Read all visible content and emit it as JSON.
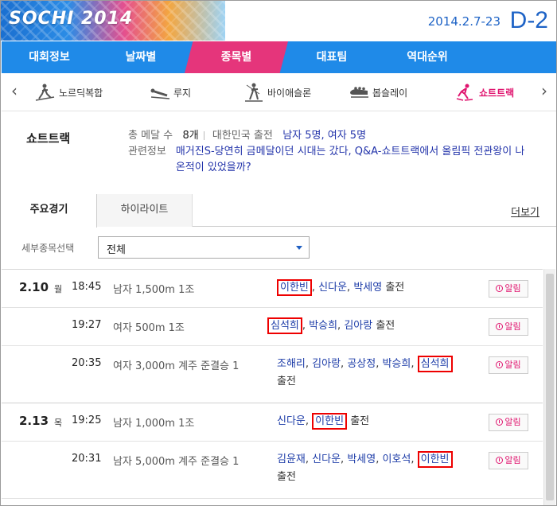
{
  "header": {
    "logo": "SOCHI 2014",
    "dates": "2014.2.7-23",
    "dday": "D-2"
  },
  "main_nav": [
    "대회정보",
    "날짜별",
    "종목별",
    "대표팀",
    "역대순위"
  ],
  "main_nav_active": "종목별",
  "sports": [
    {
      "label": "노르딕복합",
      "icon": "nordic-combined-icon"
    },
    {
      "label": "루지",
      "icon": "luge-icon"
    },
    {
      "label": "바이애슬론",
      "icon": "biathlon-icon"
    },
    {
      "label": "봅슬레이",
      "icon": "bobsleigh-icon"
    },
    {
      "label": "쇼트트랙",
      "icon": "short-track-icon",
      "active": true
    }
  ],
  "sport_info": {
    "title": "쇼트트랙",
    "medal_label": "총 메달 수",
    "medal_value": "8개",
    "entry_label": "대한민국 출전",
    "entry_value": "남자 5명, 여자 5명",
    "related_label": "관련정보",
    "related_link": "매거진S-당연히 금메달이던 시대는 갔다, Q&A-쇼트트랙에서 올림픽 전관왕이 나온적이 있었을까?"
  },
  "tabs": [
    "주요경기",
    "하이라이트"
  ],
  "more_label": "더보기",
  "filter": {
    "label": "세부종목선택",
    "value": "전체"
  },
  "schedule": [
    {
      "date": "2.10",
      "dow": "월",
      "time": "18:45",
      "event": "남자 1,500m 1조",
      "athletes": [
        {
          "name": "이한빈",
          "highlight": true
        },
        {
          "name": "신다운"
        },
        {
          "name": "박세영"
        }
      ],
      "suffix": "출전",
      "alarm": "알림"
    },
    {
      "date": "",
      "dow": "",
      "time": "19:27",
      "event": "여자 500m 1조",
      "athletes": [
        {
          "name": "심석희",
          "highlight": true
        },
        {
          "name": "박승희"
        },
        {
          "name": "김아랑"
        }
      ],
      "suffix": "출전",
      "alarm": "알림"
    },
    {
      "date": "",
      "dow": "",
      "time": "20:35",
      "event": "여자 3,000m 계주 준결승 1",
      "athletes": [
        {
          "name": "조해리"
        },
        {
          "name": "김아랑"
        },
        {
          "name": "공상정"
        },
        {
          "name": "박승희"
        },
        {
          "name": "심석희",
          "highlight": true
        }
      ],
      "suffix": "출전",
      "alarm": "알림"
    },
    {
      "date": "2.13",
      "dow": "목",
      "time": "19:25",
      "event": "남자 1,000m 1조",
      "athletes": [
        {
          "name": "신다운"
        },
        {
          "name": "이한빈",
          "highlight": true
        }
      ],
      "suffix": "출전",
      "alarm": "알림"
    },
    {
      "date": "",
      "dow": "",
      "time": "20:31",
      "event": "남자 5,000m 계주 준결승 1",
      "athletes": [
        {
          "name": "김윤재"
        },
        {
          "name": "신다운"
        },
        {
          "name": "박세영"
        },
        {
          "name": "이호석"
        },
        {
          "name": "이한빈",
          "highlight": true
        }
      ],
      "suffix": "출전",
      "alarm": "알림"
    }
  ],
  "colors": {
    "nav_blue": "#1f8ae8",
    "nav_active_pink": "#e5357b",
    "link_blue": "#1d3ca8",
    "highlight_red": "#ee0000",
    "accent_pink": "#e0156f"
  }
}
